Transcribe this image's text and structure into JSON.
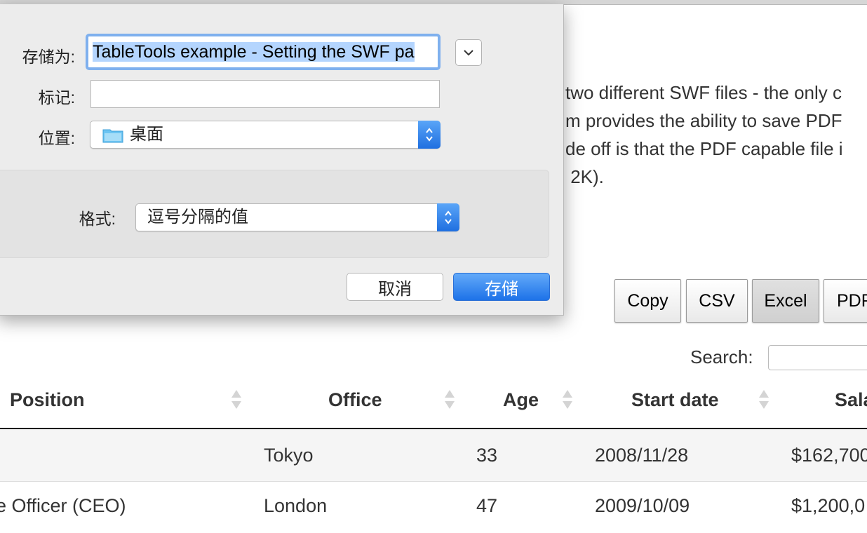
{
  "page": {
    "description_lines": [
      "two different SWF files - the only c",
      "m provides the ability to save PDF",
      "de off is that the PDF capable file i",
      " 2K)."
    ],
    "buttons": [
      "Copy",
      "CSV",
      "Excel",
      "PDF"
    ],
    "active_button": "Excel",
    "search_label": "Search:",
    "search_value": ""
  },
  "table": {
    "columns": [
      "Position",
      "Office",
      "Age",
      "Start date",
      "Sala"
    ],
    "rows": [
      {
        "position": "",
        "office": "Tokyo",
        "age": "33",
        "start_date": "2008/11/28",
        "salary": "$162,700"
      },
      {
        "position": "e Officer (CEO)",
        "office": "London",
        "age": "47",
        "start_date": "2009/10/09",
        "salary": "$1,200,0"
      }
    ]
  },
  "dialog": {
    "save_as_label": "存储为:",
    "filename": "TableTools example - Setting the SWF pa",
    "tags_label": "标记:",
    "tags_value": "",
    "location_label": "位置:",
    "location_value": "桌面",
    "format_label": "格式:",
    "format_value": "逗号分隔的值",
    "cancel_label": "取消",
    "save_label": "存储",
    "icons": {
      "expand": "chevron-down-icon",
      "location": "folder-icon",
      "stepper": "up-down-chevron-icon"
    },
    "colors": {
      "primary_button": "#1d72e8",
      "focus_ring": "#7fb0ee",
      "selection": "#b4d5fe"
    }
  }
}
